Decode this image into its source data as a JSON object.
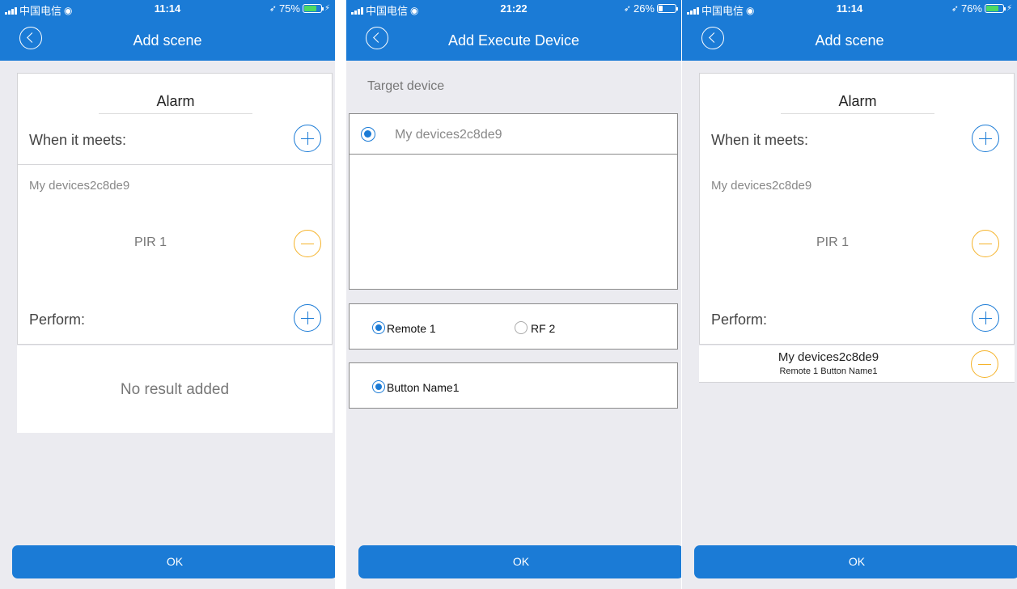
{
  "screens": [
    {
      "status": {
        "carrier": "中国电信",
        "time": "11:14",
        "battery": "75%"
      },
      "title": "Add scene",
      "scene_name": "Alarm",
      "when_label": "When it meets:",
      "condition": {
        "device": "My devices2c8de9",
        "value": "PIR 1"
      },
      "perform_label": "Perform:",
      "empty_text": "No result added",
      "ok_label": "OK"
    },
    {
      "status": {
        "carrier": "中国电信",
        "time": "21:22",
        "battery": "26%"
      },
      "title": "Add Execute Device",
      "section_title": "Target device",
      "device_item": "My devices2c8de9",
      "channels": [
        "Remote 1",
        "RF 2"
      ],
      "buttons": [
        "Button Name1"
      ],
      "ok_label": "OK"
    },
    {
      "status": {
        "carrier": "中国电信",
        "time": "11:14",
        "battery": "76%"
      },
      "title": "Add scene",
      "scene_name": "Alarm",
      "when_label": "When it meets:",
      "condition": {
        "device": "My devices2c8de9",
        "value": "PIR 1"
      },
      "perform_label": "Perform:",
      "result": {
        "device": "My devices2c8de9",
        "detail": "Remote 1 Button Name1"
      },
      "ok_label": "OK"
    }
  ],
  "battery_levels": [
    0.75,
    0.26,
    0.76
  ],
  "colors": {
    "header": "#1b7bd6",
    "add_icon": "#1b7bd6",
    "remove_icon": "#f5b32a",
    "battery_high": "#4cd964",
    "battery_low": "#ffffff"
  },
  "icons": {
    "back": "chevron-left-circle-icon",
    "add": "plus-circle-icon",
    "remove": "minus-circle-icon",
    "wifi": "wifi-icon",
    "location": "location-arrow-icon",
    "charging": "bolt-icon"
  }
}
